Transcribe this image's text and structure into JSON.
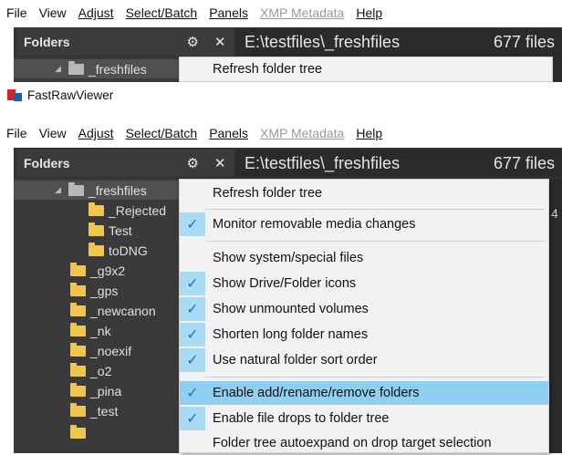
{
  "menu_bar": {
    "items": [
      {
        "label": "File"
      },
      {
        "label": "View"
      },
      {
        "label": "Adjust"
      },
      {
        "label": "Select/Batch"
      },
      {
        "label": "Panels"
      },
      {
        "label": "XMP Metadata"
      },
      {
        "label": "Help"
      }
    ]
  },
  "window": {
    "title": "FastRawViewer"
  },
  "folders_panel": {
    "title": "Folders",
    "gear_glyph": "⚙",
    "close_glyph": "✕"
  },
  "path_bar": {
    "path": "E:\\testfiles\\_freshfiles",
    "file_count": "677 files",
    "trailing_digit": "4"
  },
  "tree": {
    "items": [
      {
        "label": "_freshfiles",
        "level": 0,
        "expanded": true,
        "icon": "folder-gray-icon",
        "selected": true
      },
      {
        "label": "_Rejected",
        "level": 1,
        "icon": "folder-icon"
      },
      {
        "label": "Test",
        "level": 1,
        "icon": "folder-icon"
      },
      {
        "label": "toDNG",
        "level": 1,
        "icon": "folder-icon"
      },
      {
        "label": "_g9x2",
        "level": 0,
        "icon": "folder-icon"
      },
      {
        "label": "_gps",
        "level": 0,
        "icon": "folder-icon"
      },
      {
        "label": "_newcanon",
        "level": 0,
        "icon": "folder-icon"
      },
      {
        "label": "_nk",
        "level": 0,
        "icon": "folder-icon"
      },
      {
        "label": "_noexif",
        "level": 0,
        "icon": "folder-icon"
      },
      {
        "label": "_o2",
        "level": 0,
        "icon": "folder-icon"
      },
      {
        "label": "_pina",
        "level": 0,
        "icon": "folder-icon"
      },
      {
        "label": "_test",
        "level": 0,
        "icon": "folder-icon"
      }
    ]
  },
  "context_menu": {
    "items": [
      {
        "label": "Refresh folder tree",
        "checked": false,
        "highlighted": false
      },
      {
        "label": "Monitor removable media changes",
        "checked": true,
        "highlighted": false
      },
      {
        "label": "Show system/special files",
        "checked": false,
        "highlighted": false
      },
      {
        "label": "Show Drive/Folder icons",
        "checked": true,
        "highlighted": false
      },
      {
        "label": "Show unmounted volumes",
        "checked": true,
        "highlighted": false
      },
      {
        "label": "Shorten long folder names",
        "checked": true,
        "highlighted": false
      },
      {
        "label": "Use natural folder sort order",
        "checked": true,
        "highlighted": false
      },
      {
        "label": "Enable add/rename/remove folders",
        "checked": true,
        "highlighted": true
      },
      {
        "label": "Enable file drops to folder tree",
        "checked": true,
        "highlighted": false
      },
      {
        "label": "Folder tree autoexpand on drop target selection",
        "checked": false,
        "highlighted": false
      }
    ],
    "check_glyph": "✓"
  },
  "colors": {
    "highlight": "#8fd0f2",
    "check_column": "#a9dbf5",
    "folder": "#f2c64b",
    "dark_panel": "#3a3a3a"
  }
}
